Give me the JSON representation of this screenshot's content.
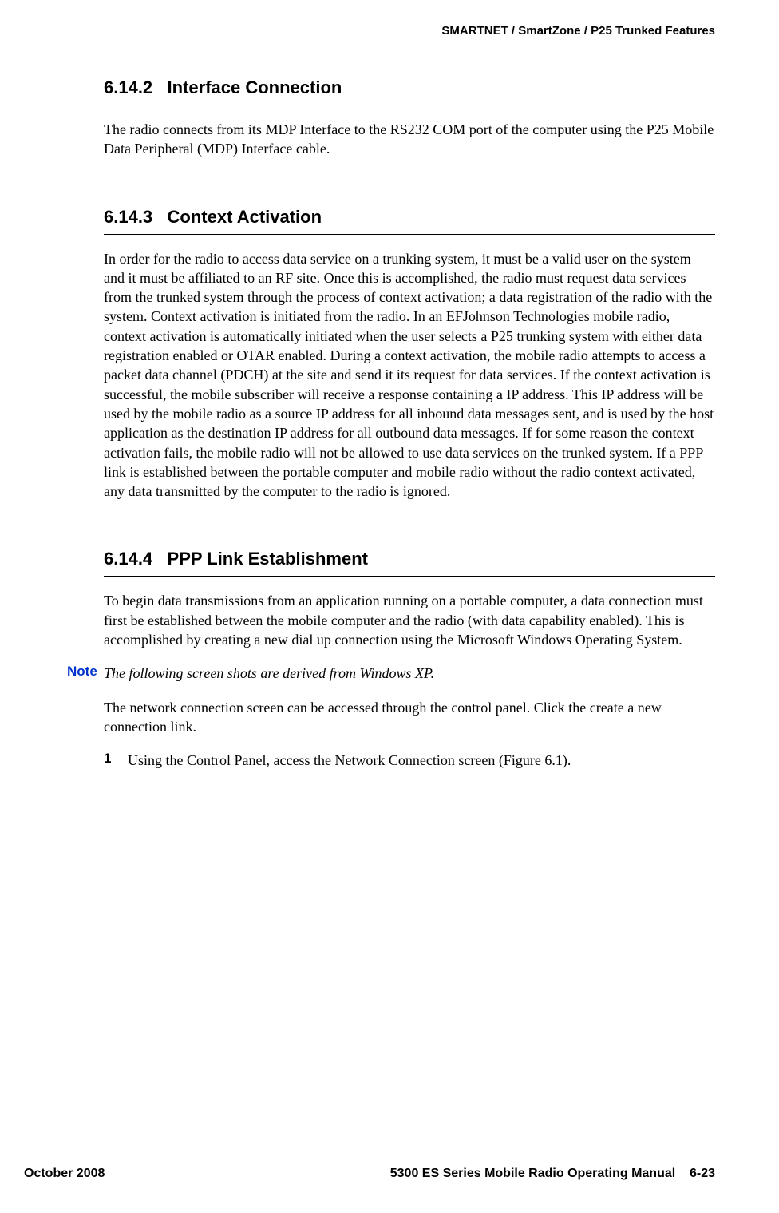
{
  "header": {
    "rightText": "SMARTNET / SmartZone / P25 Trunked Features"
  },
  "sections": {
    "s1": {
      "num": "6.14.2",
      "title": "Interface Connection",
      "body": "The radio connects from its MDP Interface to the RS232 COM port of the computer using the P25 Mobile Data Peripheral (MDP) Interface cable."
    },
    "s2": {
      "num": "6.14.3",
      "title": "Context Activation",
      "body": "In order for the radio to access data service on a trunking system, it must be a valid user on the system and it must be affiliated to an RF site. Once this is accomplished, the radio must request data services from the trunked system through the process of context activation; a data registration of the radio with the system. Context activation is initiated from the radio. In an EFJohnson Technologies mobile radio, context activation is automatically initiated when the user selects a P25 trunking system with either data registration enabled or OTAR enabled. During a context activation, the mobile radio attempts to access a packet data channel (PDCH) at the site and send it its request for data services. If the context activation is successful, the mobile subscriber will receive a response containing a IP address. This IP address will be used by the mobile radio as a source IP address for all inbound data messages sent, and is used by the host application as the destination IP address for all outbound data messages. If for some reason the context activation fails, the mobile radio will not be allowed to use data services on the trunked system. If a PPP link is established between the portable computer and mobile radio without the radio context activated, any data transmitted by the computer to the radio is ignored."
    },
    "s3": {
      "num": "6.14.4",
      "title": "PPP Link Establishment",
      "body": "To begin data transmissions from an application running on a portable computer, a data connection must first be established between the mobile computer and the radio (with data capability enabled). This is accomplished by creating a new dial up connection using the Microsoft Windows Operating System.",
      "noteLabel": "Note",
      "noteText": "The following screen shots are derived from Windows XP.",
      "body2": "The network connection screen can be accessed through the control panel. Click the create a new connection link.",
      "step1Num": "1",
      "step1Text": "Using the Control Panel, access the Network Connection screen (Figure 6.1)."
    }
  },
  "footer": {
    "left": "October 2008",
    "rightManual": "5300 ES Series Mobile Radio Operating Manual",
    "rightPage": "6-23"
  }
}
